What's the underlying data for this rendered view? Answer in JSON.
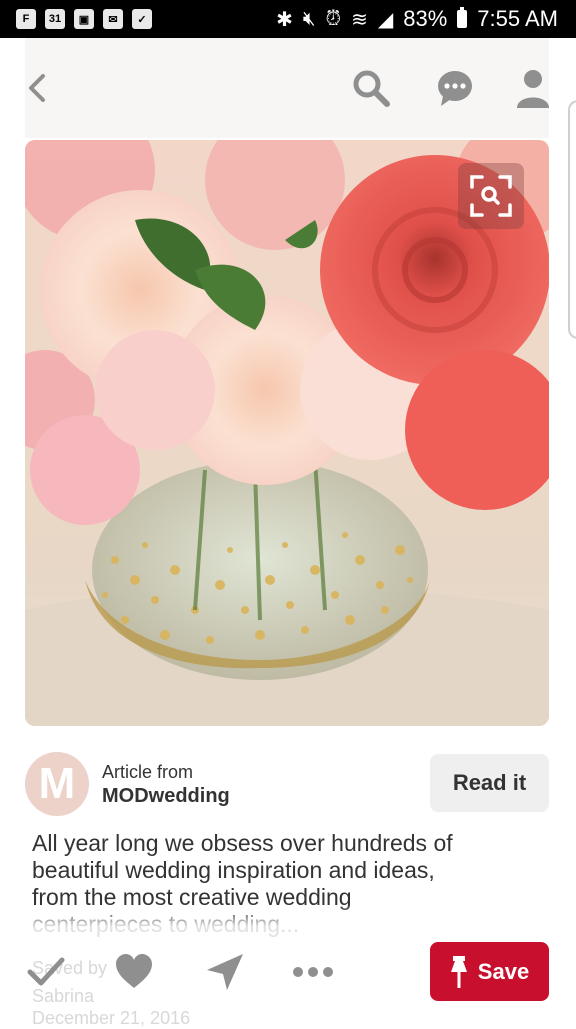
{
  "status_bar": {
    "left_icons": [
      "flipboard-icon",
      "calendar-icon",
      "gallery-icon",
      "message-icon",
      "clipboard-check-icon"
    ],
    "calendar_date": "31",
    "battery": "83%",
    "time": "7:55 AM"
  },
  "nav": {
    "icons": [
      "back-icon",
      "search-icon",
      "chat-icon",
      "profile-icon"
    ]
  },
  "pin": {
    "image_subject": "pink and coral flowers in a gold glitter vase"
  },
  "source": {
    "avatar_letter": "M",
    "article_from": "Article from",
    "name": "MODwedding",
    "read_label": "Read it"
  },
  "description": "All year long we obsess over hundreds of beautiful wedding inspiration and ideas, from the most creative wedding centerpieces to wedding...",
  "faded": {
    "line1": "Saved by",
    "line2": "Sabrina",
    "line3": "December 21, 2016"
  },
  "actions": {
    "icons": [
      "checkmark-icon",
      "heart-icon",
      "send-icon",
      "more-icon"
    ],
    "save_label": "Save"
  },
  "colors": {
    "save": "#c8102e",
    "read_bg": "#efefef",
    "nav_icon": "#8f8f8f",
    "avatar_bg": "#ecd2c9"
  }
}
